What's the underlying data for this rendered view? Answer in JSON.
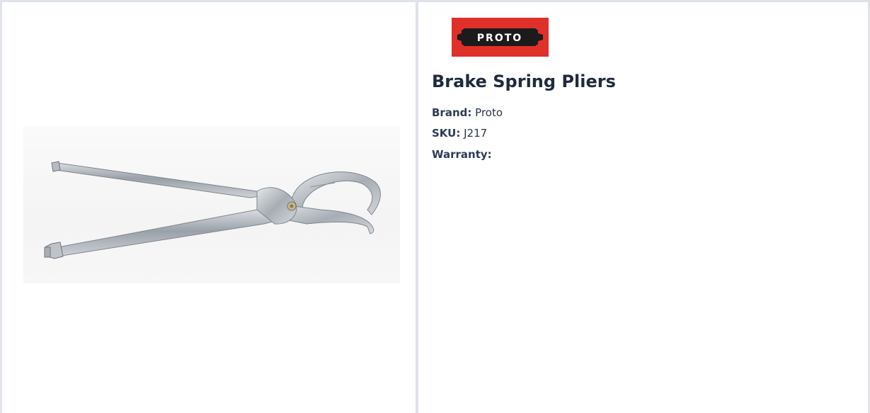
{
  "brand_logo": {
    "text": "PROTO",
    "background": "#e0302a"
  },
  "product": {
    "title": "Brake Spring Pliers",
    "brand_label": "Brand:",
    "brand_value": "Proto",
    "sku_label": "SKU:",
    "sku_value": "J217",
    "warranty_label": "Warranty:",
    "warranty_value": ""
  },
  "image": {
    "subject": "brake-spring-pliers-photo"
  },
  "colors": {
    "title": "#1f2a3c",
    "border": "#dfe3ea",
    "logo_red": "#e0302a"
  }
}
